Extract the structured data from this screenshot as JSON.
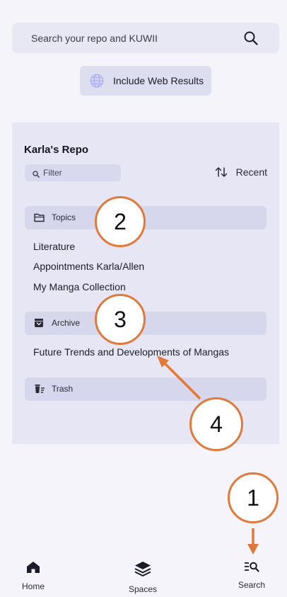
{
  "search": {
    "placeholder": "Search your repo and KUWII",
    "icon": "search-icon"
  },
  "web_results": {
    "label": "Include Web Results",
    "icon": "globe-icon"
  },
  "repo": {
    "title": "Karla's Repo",
    "filter_placeholder": "Filter",
    "sort_label": "Recent",
    "sections": [
      {
        "label": "Topics",
        "icon": "folder-icon",
        "items": [
          "Literature",
          "Appointments Karla/Allen",
          "My Manga Collection"
        ]
      },
      {
        "label": "Archive",
        "icon": "archive-icon",
        "items": [
          "Future Trends and Developments of Mangas"
        ]
      },
      {
        "label": "Trash",
        "icon": "trash-icon",
        "items": []
      }
    ]
  },
  "callouts": [
    "1",
    "2",
    "3",
    "4"
  ],
  "nav": [
    {
      "label": "Home",
      "icon": "home-icon"
    },
    {
      "label": "Spaces",
      "icon": "layers-icon"
    },
    {
      "label": "Search",
      "icon": "search-list-icon"
    }
  ],
  "colors": {
    "accent": "#e07a3c",
    "panel": "#e6e6f5",
    "section": "#d6d6ec"
  }
}
